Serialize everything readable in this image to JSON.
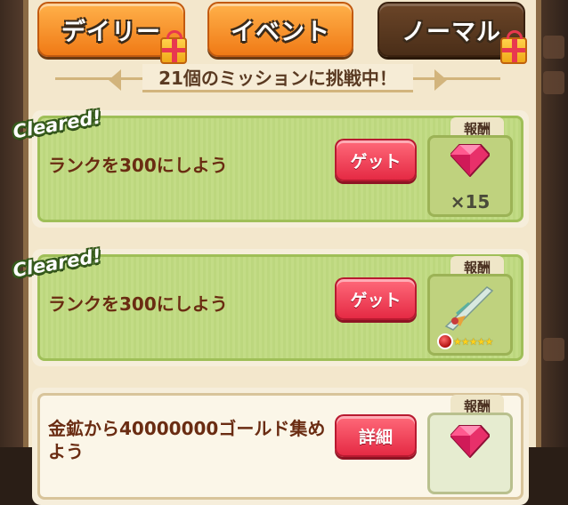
{
  "tabs": [
    {
      "label": "デイリー",
      "has_gift": true
    },
    {
      "label": "イベント",
      "has_gift": false
    },
    {
      "label": "ノーマル",
      "has_gift": true
    }
  ],
  "banner": {
    "text": "21個のミッションに挑戦中！"
  },
  "missions": [
    {
      "status": "Cleared!",
      "title": "ランクを300にしよう",
      "button": "ゲット",
      "reward_label": "報酬",
      "reward_icon": "gem-icon",
      "reward_qty": "×15"
    },
    {
      "status": "Cleared!",
      "title": "ランクを300にしよう",
      "button": "ゲット",
      "reward_label": "報酬",
      "reward_icon": "sword-icon",
      "reward_stars": "★★★★★"
    },
    {
      "status": "",
      "title": "金鉱から40000000ゴールド集め",
      "title_line2": "よう",
      "button": "詳細",
      "reward_label": "報酬",
      "reward_icon": "gem-icon"
    }
  ],
  "colors": {
    "accent_orange": "#f07a16",
    "active_tab": "#4a2e18",
    "button_red": "#e52a44",
    "cleared_green": "#c3dc86"
  }
}
